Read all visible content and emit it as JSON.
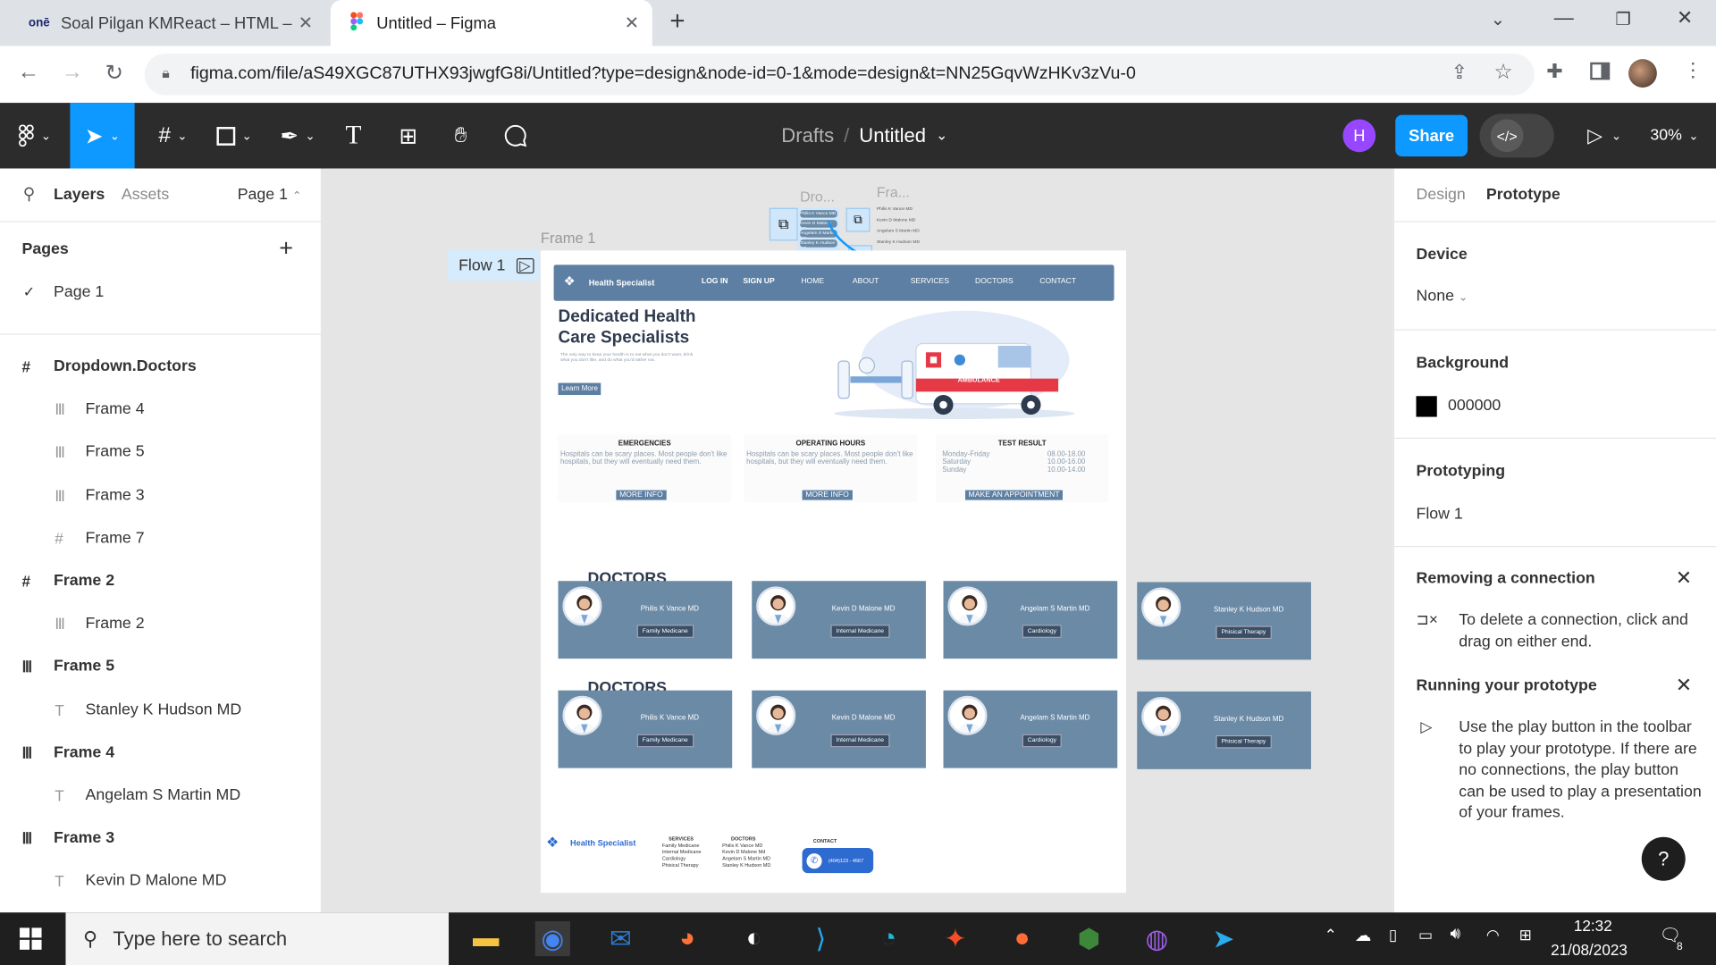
{
  "browser": {
    "tabs": [
      {
        "favicon": "onē",
        "title": "Soal Pilgan KMReact – HTML – O"
      },
      {
        "favicon": "figma-icon",
        "title": "Untitled – Figma"
      }
    ],
    "url": "figma.com/file/aS49XGC87UTHX93jwgfG8i/Untitled?type=design&node-id=0-1&mode=design&t=NN25GqvWzHKv3zVu-0"
  },
  "toolbar": {
    "breadcrumb_drafts": "Drafts",
    "separator": "/",
    "file_name": "Untitled",
    "avatar_letter": "H",
    "share_label": "Share",
    "zoom": "30%"
  },
  "left_panel": {
    "tab_layers": "Layers",
    "tab_assets": "Assets",
    "page_selector": "Page 1",
    "pages_heading": "Pages",
    "page_item": "Page 1",
    "layers": [
      {
        "icon": "frame-icon",
        "label": "Dropdown.Doctors",
        "bold": true,
        "indent": 0
      },
      {
        "icon": "autolayout-icon",
        "label": "Frame 4",
        "bold": false,
        "indent": 1
      },
      {
        "icon": "autolayout-icon",
        "label": "Frame 5",
        "bold": false,
        "indent": 1
      },
      {
        "icon": "autolayout-icon",
        "label": "Frame 3",
        "bold": false,
        "indent": 1
      },
      {
        "icon": "frame-icon",
        "label": "Frame 7",
        "bold": false,
        "indent": 1
      },
      {
        "icon": "frame-icon",
        "label": "Frame 2",
        "bold": true,
        "indent": 0
      },
      {
        "icon": "autolayout-icon",
        "label": "Frame 2",
        "bold": false,
        "indent": 1
      },
      {
        "icon": "autolayout-icon",
        "label": "Frame 5",
        "bold": true,
        "indent": 0
      },
      {
        "icon": "text-icon",
        "label": "Stanley K Hudson MD",
        "bold": false,
        "indent": 1
      },
      {
        "icon": "autolayout-icon",
        "label": "Frame 4",
        "bold": true,
        "indent": 0
      },
      {
        "icon": "text-icon",
        "label": "Angelam S Martin MD",
        "bold": false,
        "indent": 1
      },
      {
        "icon": "autolayout-icon",
        "label": "Frame 3",
        "bold": true,
        "indent": 0
      },
      {
        "icon": "text-icon",
        "label": "Kevin D Malone MD",
        "bold": false,
        "indent": 1
      }
    ]
  },
  "right_panel": {
    "tab_design": "Design",
    "tab_prototype": "Prototype",
    "device_heading": "Device",
    "device_value": "None",
    "background_heading": "Background",
    "background_value": "000000",
    "prototyping_heading": "Prototyping",
    "flow_value": "Flow 1",
    "removing_title": "Removing a connection",
    "removing_text": "To delete a connection, click and drag on either end.",
    "running_title": "Running your prototype",
    "running_text": "Use the play button in the toolbar to play your prototype. If there are no connections, the play button can be used to play a presentation of your frames.",
    "help": "?"
  },
  "canvas": {
    "flow_label": "Flow 1",
    "frame_label": "Frame 1",
    "drop_label": "Dro...",
    "fra_label": "Fra...",
    "site": {
      "logo": "Health Specialist",
      "nav": [
        "LOG IN",
        "SIGN UP",
        "HOME",
        "ABOUT",
        "SERVICES",
        "DOCTORS",
        "CONTACT"
      ],
      "hero_title": "Dedicated Health Care Specialists",
      "hero_sub": "The only way to keep your health is to eat what you don't want, drink what you don't like, and do what you'd rather not.",
      "learn_more": "Learn More",
      "ambulance": "AMBULANCE",
      "boxes": [
        {
          "title": "EMERGENCIES",
          "text": "Hospitals can be scary places. Most people don't like hospitals, but they will eventually need them.",
          "button": "MORE INFO"
        },
        {
          "title": "OPERATING HOURS",
          "text": "Hospitals can be scary places. Most people don't like hospitals, but they will eventually need them.",
          "button": "MORE INFO"
        },
        {
          "title": "TEST RESULT",
          "rows": [
            [
              "Monday-Friday",
              "08.00-18.00"
            ],
            [
              "Saturday",
              "10.00-16.00"
            ],
            [
              "Sunday",
              "10.00-14.00"
            ]
          ],
          "button": "MAKE AN APPOINTMENT"
        }
      ],
      "doctors_heading": "DOCTORS",
      "doctors": [
        {
          "name": "Philis K Vance MD",
          "specialty": "Family Medicane"
        },
        {
          "name": "Kevin D Malone MD",
          "specialty": "Internal Medicane"
        },
        {
          "name": "Angelam S Martin MD",
          "specialty": "Cardiology"
        },
        {
          "name": "Stanley K Hudson MD",
          "specialty": "Phisical Therapy"
        }
      ],
      "footer": {
        "logo": "Health Specialist",
        "services_title": "SERVICES",
        "services": [
          "Family Medicane",
          "Internal Medicane",
          "Cardiology",
          "Phisical Therapy"
        ],
        "doctors_title": "DOCTORS",
        "doctors": [
          "Philis K Vance MD",
          "Kevin D Malone Md",
          "Angelam S Martin MD",
          "Stanley K Hudson MD"
        ],
        "contact_title": "CONTACT",
        "phone": "(404)123 - 4567"
      },
      "dropdown_items": [
        "Philis K Vance MD",
        "Kevin D Malone MD",
        "Angelam S Martin MD",
        "Stanley K Hudson MD"
      ]
    }
  },
  "taskbar": {
    "search_placeholder": "Type here to search",
    "time": "12:32",
    "date": "21/08/2023",
    "notifications": "8"
  },
  "colors": {
    "figma_blue": "#0d99ff",
    "toolbar": "#2c2c2c",
    "site_nav": "#5d7fa3",
    "card": "#6b8aa6"
  }
}
